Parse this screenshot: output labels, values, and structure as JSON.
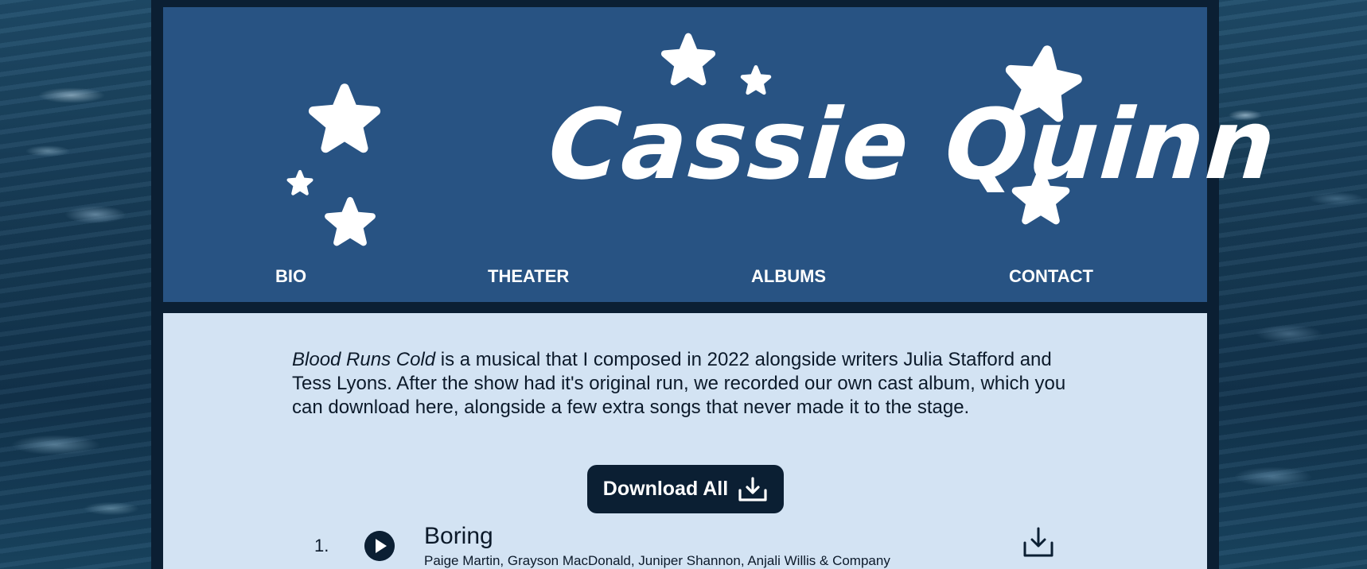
{
  "site": {
    "title": "Cassie Quinn"
  },
  "nav": {
    "items": [
      {
        "label": "BIO"
      },
      {
        "label": "THEATER"
      },
      {
        "label": "ALBUMS"
      },
      {
        "label": "CONTACT"
      }
    ]
  },
  "intro": {
    "title_italic": "Blood Runs Cold",
    "text": " is a musical that I composed in 2022 alongside writers Julia Stafford and Tess Lyons. After the show had it's original run, we recorded our own cast album, which you can download here, alongside a few extra songs that never made it to the stage."
  },
  "download_all": {
    "label": "Download All",
    "icon": "download-icon"
  },
  "tracks": [
    {
      "number": "1.",
      "title": "Boring",
      "artists": "Paige Martin, Grayson MacDonald, Juniper Shannon, Anjali Willis & Company",
      "play_icon": "play-icon",
      "download_icon": "download-icon"
    }
  ],
  "colors": {
    "header_bg": "#285383",
    "content_bg": "#d3e3f3",
    "frame_bg": "#0b1f33",
    "button_bg": "#0b1f33",
    "text": "#0c1a2a"
  }
}
